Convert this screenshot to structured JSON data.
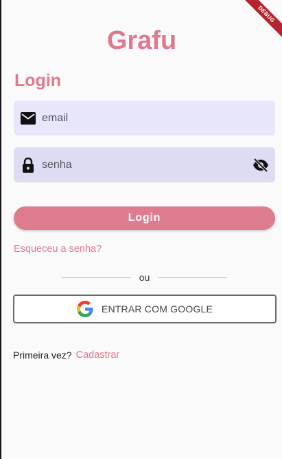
{
  "app": {
    "title": "Grafu",
    "debug_banner": "DEBUG"
  },
  "login": {
    "section_title": "Login",
    "email": {
      "placeholder": "email",
      "value": ""
    },
    "password": {
      "placeholder": "senha",
      "value": ""
    },
    "login_button": "Login",
    "forgot_link": "Esqueceu a senha?",
    "divider_text": "ou",
    "google_button": "ENTRAR COM GOOGLE",
    "signup_question": "Primeira vez?",
    "signup_link": "Cadastrar"
  },
  "icons": {
    "email": "mail-icon",
    "password": "lock-icon",
    "visibility": "eye-off-icon",
    "google": "google-icon"
  },
  "colors": {
    "accent": "#e07890",
    "button": "#df7b8f",
    "email_field_bg": "#e8e6fb",
    "password_field_bg": "#dedcf3",
    "debug_banner": "#b3262f"
  }
}
